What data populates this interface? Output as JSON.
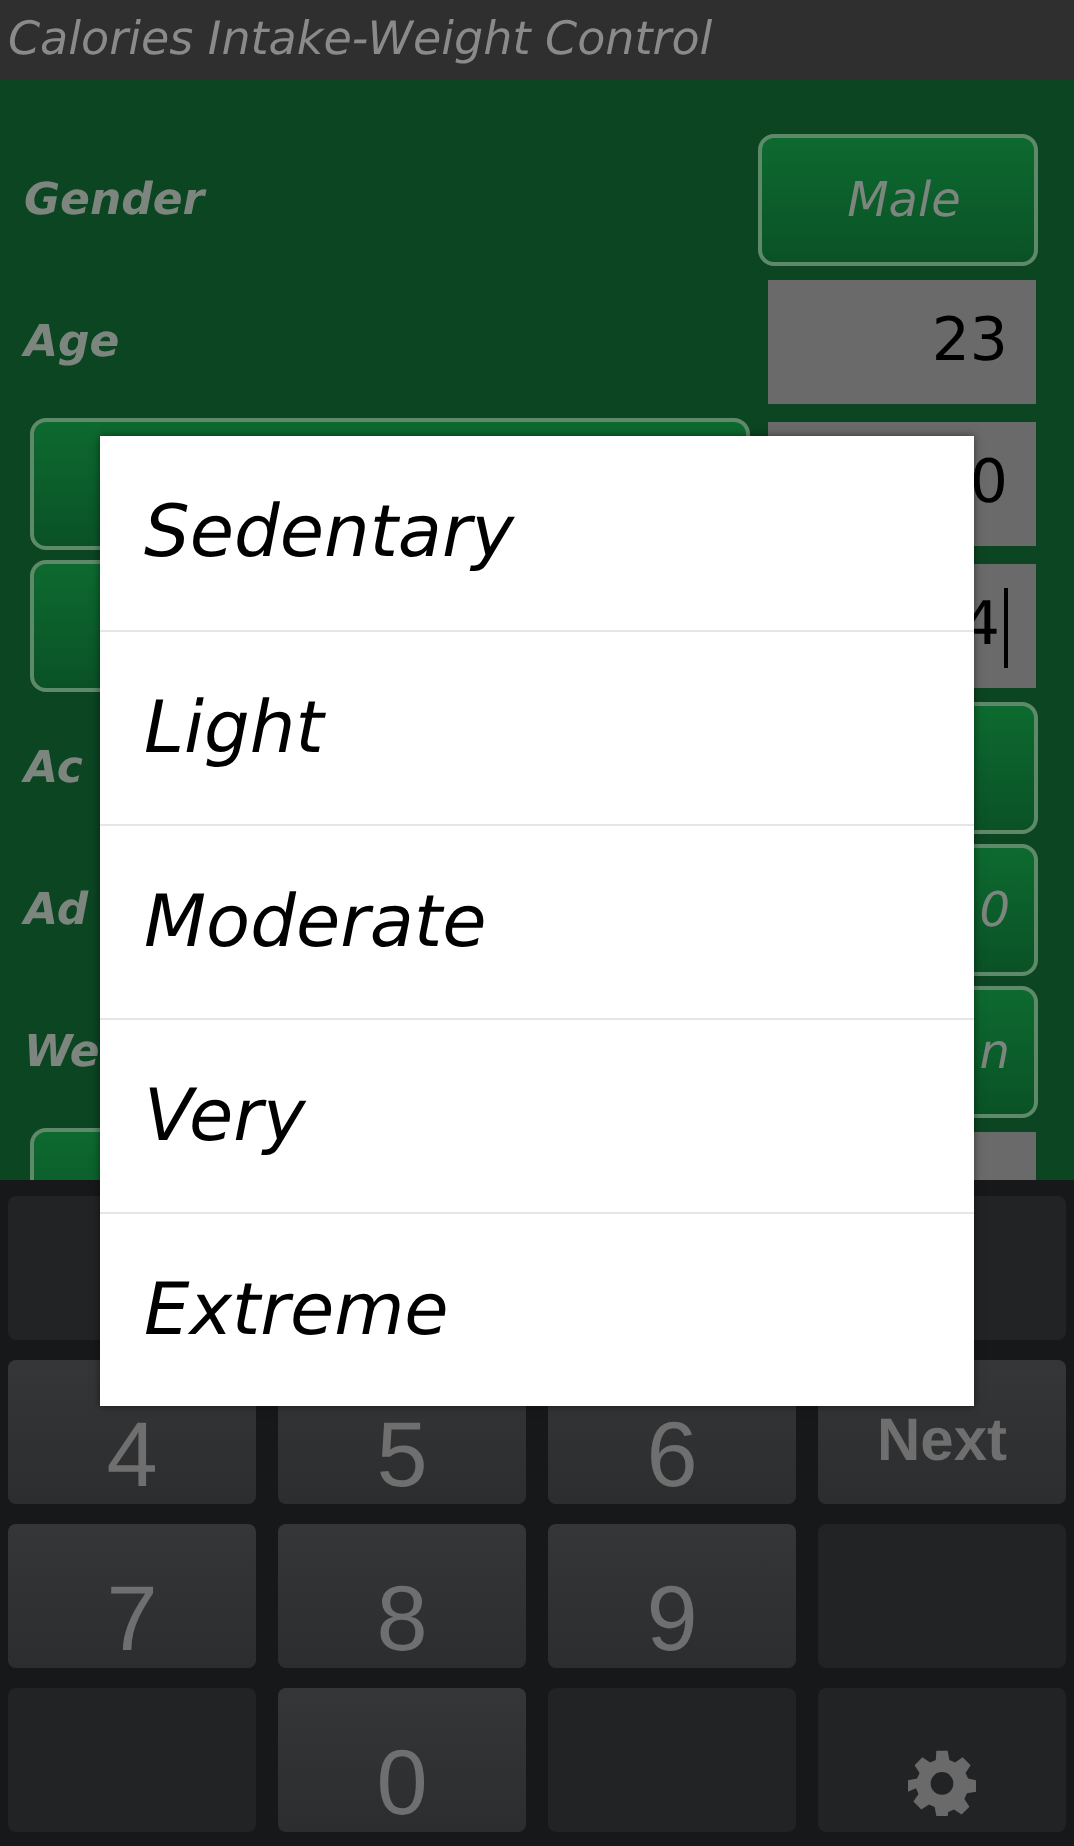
{
  "title": "Calories Intake-Weight Control",
  "form": {
    "rows": [
      {
        "kind": "label-button",
        "label": "Gender",
        "value": "Male"
      },
      {
        "kind": "label-field",
        "label": "Age",
        "value": "23"
      },
      {
        "kind": "button-field",
        "value": "0"
      },
      {
        "kind": "button-field",
        "value": "4",
        "focused": true
      },
      {
        "kind": "label-button",
        "label": "Ac"
      },
      {
        "kind": "label-button",
        "label": "Ad",
        "value": "0"
      },
      {
        "kind": "label-button",
        "label": "We",
        "value": "n"
      },
      {
        "kind": "button-field"
      }
    ]
  },
  "dialog": {
    "items": [
      "Sedentary",
      "Light",
      "Moderate",
      "Very",
      "Extreme"
    ]
  },
  "keyboard": {
    "keys": [
      {
        "kind": "blank"
      },
      {
        "kind": "blank"
      },
      {
        "kind": "key",
        "label": "4"
      },
      {
        "kind": "key",
        "label": "5"
      },
      {
        "kind": "key",
        "label": "6"
      },
      {
        "kind": "key",
        "label": "Next"
      },
      {
        "kind": "key",
        "label": "7"
      },
      {
        "kind": "key",
        "label": "8"
      },
      {
        "kind": "key",
        "label": "9"
      },
      {
        "kind": "blank"
      },
      {
        "kind": "blank"
      },
      {
        "kind": "key",
        "label": "0"
      },
      {
        "kind": "blank"
      },
      {
        "kind": "settings"
      }
    ]
  }
}
